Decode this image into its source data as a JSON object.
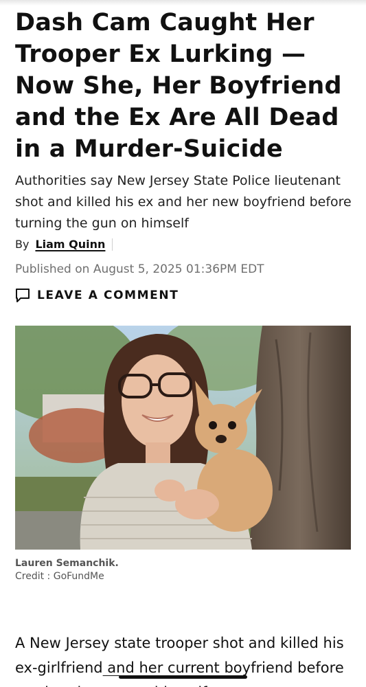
{
  "article": {
    "headline": "Dash Cam Caught Her Trooper Ex Lurking — Now She, Her Boyfriend and the Ex Are All Dead in a Murder-Suicide",
    "subheadline": "Authorities say New Jersey State Police lieutenant shot and killed his ex and her new boyfriend before turning the gun on himself",
    "byline": {
      "prefix": "By",
      "author": "Liam Quinn"
    },
    "published": "Published on August 5, 2025 01:36PM EDT",
    "comment_link": {
      "label": "LEAVE A COMMENT",
      "icon": "speech-bubble-icon"
    },
    "photo": {
      "caption_name": "Lauren Semanchik.",
      "caption_credit": "Credit : GoFundMe"
    },
    "body_start": {
      "part1": "A New Jersey state trooper shot and killed his ex-girlfriend",
      "link_text": " and her current",
      "part2": " boyfriend before turning the gun on himself"
    }
  },
  "colors": {
    "text": "#111111",
    "muted": "#6f6f6f",
    "caption": "#555555"
  }
}
